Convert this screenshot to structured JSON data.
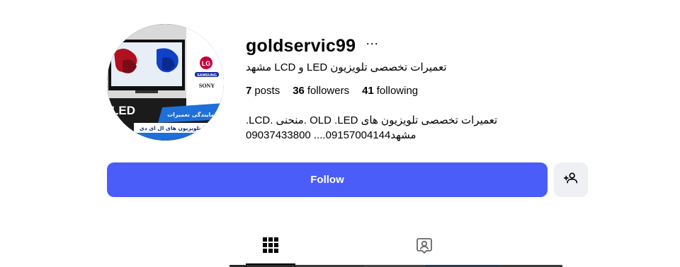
{
  "profile": {
    "username": "goldservic99",
    "more_icon": "···",
    "full_name": "تعمیرات تخصصی تلویزیون LED و LCD مشهد",
    "stats": {
      "posts_count": "7",
      "posts_label": "posts",
      "followers_count": "36",
      "followers_label": "followers",
      "following_count": "41",
      "following_label": "following"
    },
    "bio_lines": [
      "تعمیرات تخصصی تلویزیون های OLD .LED .منحنی .LCD.",
      "09037433800 ....09157004144مشهد"
    ],
    "avatar": {
      "tv_label": "LED",
      "brand_lg": "LG",
      "brand_samsung": "SAMSUNG",
      "brand_sony": "SONY",
      "banner_line1": "نمایندگی تعمیرات",
      "banner_line2": "تلویزیون های ال ای دی (LED)"
    }
  },
  "actions": {
    "follow_label": "Follow",
    "suggest_icon": "person-add-icon"
  },
  "tabs": [
    {
      "icon": "grid-icon",
      "active": true
    },
    {
      "icon": "tagged-person-icon",
      "active": false
    }
  ],
  "colors": {
    "follow_button": "#4a5df9",
    "secondary_button": "#eff0f3",
    "text": "#000000"
  }
}
